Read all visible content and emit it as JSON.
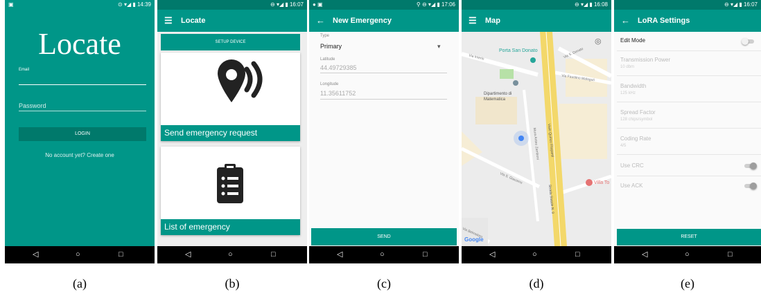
{
  "screens": {
    "a": {
      "status_time": "14:39",
      "status_icons": "⊙ ▾◢ ▮",
      "logo": "Locate",
      "email_label": "Email",
      "password_placeholder": "Password",
      "login_label": "LOGIN",
      "create_account": "No account yet? Create one"
    },
    "b": {
      "status_time": "16:07",
      "status_icons": "⊖ ▾◢ ▮",
      "title": "Locate",
      "setup_label": "SETUP DEVICE",
      "send_request_label": "Send emergency request",
      "list_label": "List of emergency"
    },
    "c": {
      "status_time": "17:06",
      "status_icons": "⚲ ⊖ ▾◢ ▮",
      "title": "New Emergency",
      "type_label": "Type",
      "type_value": "Primary",
      "latitude_label": "Latitude",
      "latitude_value": "44.49729385",
      "longitude_label": "Longitude",
      "longitude_value": "11.35611752",
      "send_label": "SEND"
    },
    "d": {
      "status_time": "16:08",
      "status_icons": "⊖ ▾◢ ▮",
      "title": "Map",
      "places": {
        "porta": "Porta San Donato",
        "dipartimento": "Dipartimento di Matematica",
        "villa": "Villa To",
        "google": "Google"
      },
      "streets": {
        "irnerio": "Via Irnerio",
        "donato": "Via S. Donato",
        "malaguti": "Via Faustino Malaguti",
        "vialeq": "Viale Quirico Filopanti",
        "zamboni": "Mura Anteo Zamboni",
        "giacomo": "Via S. Giacomo",
        "statale": "Strada Statale N. 9",
        "belmeloro": "Via Belmeloro"
      }
    },
    "e": {
      "status_time": "16:07",
      "status_icons": "⊖ ▾◢ ▮",
      "title": "LoRA Settings",
      "edit_mode": "Edit Mode",
      "edit_mode_on": false,
      "settings": [
        {
          "name": "Transmission Power",
          "value": "10 dbm"
        },
        {
          "name": "Bandwidth",
          "value": "125 kHz"
        },
        {
          "name": "Spread Factor",
          "value": "128 chips/symbol"
        },
        {
          "name": "Coding Rate",
          "value": "4/5"
        }
      ],
      "use_crc": "Use CRC",
      "use_crc_on": true,
      "use_ack": "Use ACK",
      "use_ack_on": true,
      "reset_label": "RESET"
    }
  },
  "captions": [
    "(a)",
    "(b)",
    "(c)",
    "(d)",
    "(e)"
  ],
  "nav": {
    "back": "◁",
    "home": "○",
    "recent": "□"
  },
  "icons": {
    "menu": "☰",
    "back": "←",
    "dropdown": "▾",
    "gps_target": "◎",
    "sim": "▣",
    "status_bar_left_b": "▣",
    "status_bar_left_c": "● ▣"
  },
  "colors": {
    "primary": "#009688",
    "dark": "#00796b",
    "map_road": "#f3d86a"
  }
}
